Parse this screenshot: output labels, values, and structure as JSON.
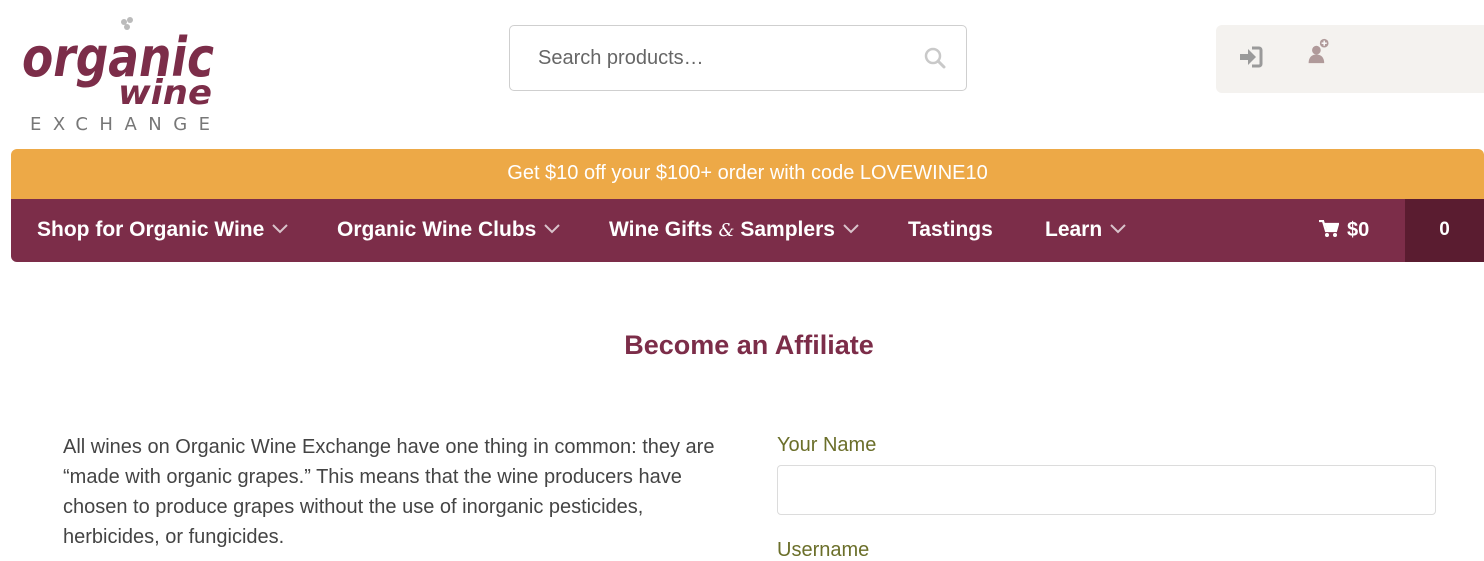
{
  "brand": {
    "logo_line1": "organic",
    "logo_line2": "wine",
    "logo_line3": "EXCHANGE",
    "primary_color": "#7c2d49",
    "accent_color": "#eda947"
  },
  "search": {
    "placeholder": "Search products…",
    "icon": "search-icon"
  },
  "account": {
    "icons": [
      "login-icon",
      "register-user-icon"
    ]
  },
  "promo": {
    "text": "Get $10 off your $100+ order with code LOVEWINE10"
  },
  "nav": {
    "items": [
      {
        "label": "Shop for Organic Wine",
        "has_dropdown": true
      },
      {
        "label": "Organic Wine Clubs",
        "has_dropdown": true
      },
      {
        "label_pre": "Wine Gifts",
        "label_amp": "&",
        "label_post": "Samplers",
        "has_dropdown": true
      },
      {
        "label": "Tastings",
        "has_dropdown": false
      },
      {
        "label": "Learn",
        "has_dropdown": true
      }
    ],
    "cart_total": "$0",
    "cart_count": "0"
  },
  "page": {
    "title": "Become an Affiliate",
    "intro": "All wines on Organic Wine Exchange have one thing in common: they are “made with organic grapes.” This means that the wine producers have chosen to produce grapes without the use of inorganic pesticides, herbicides, or fungicides."
  },
  "form": {
    "name_label": "Your Name",
    "name_value": "",
    "username_label": "Username"
  }
}
